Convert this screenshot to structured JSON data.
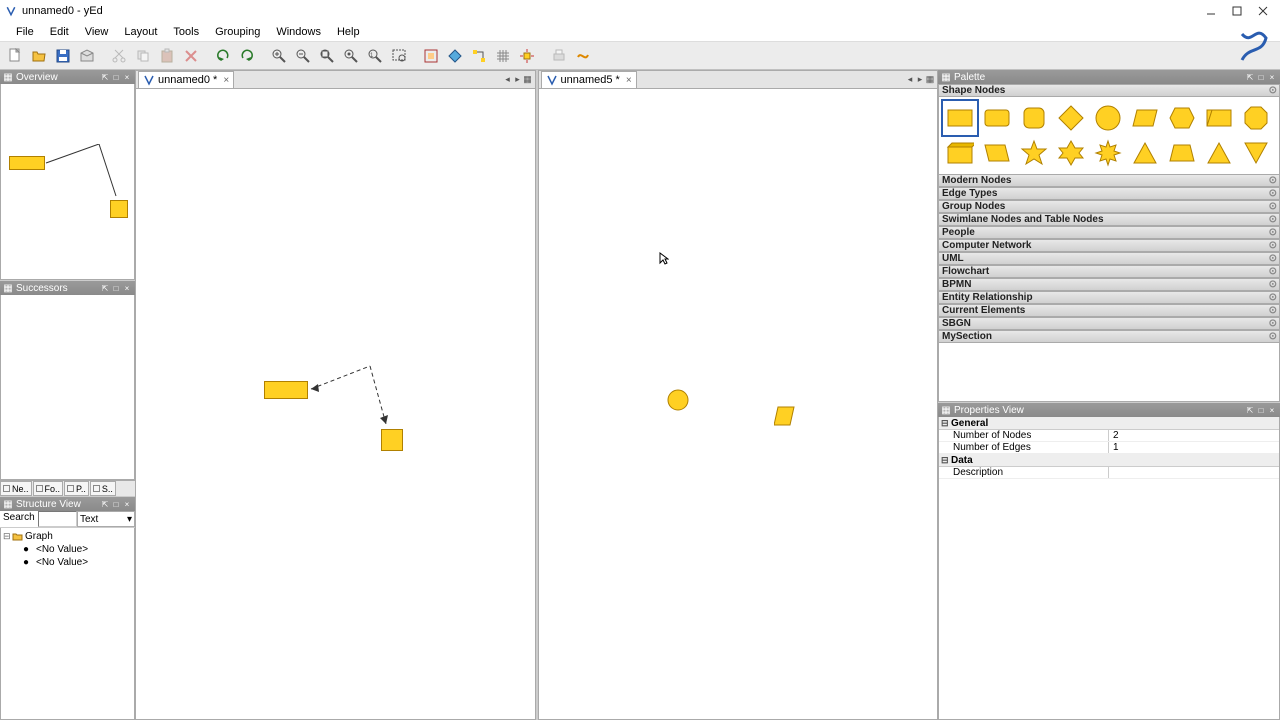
{
  "window": {
    "title": "unnamed0 - yEd"
  },
  "menu": [
    "File",
    "Edit",
    "View",
    "Layout",
    "Tools",
    "Grouping",
    "Windows",
    "Help"
  ],
  "tabs": [
    {
      "label": "unnamed0 *",
      "close": "×"
    },
    {
      "label": "unnamed5 *",
      "close": "×"
    }
  ],
  "left": {
    "overview": "Overview",
    "successors": "Successors",
    "neighborhood": "Neighborhood",
    "structure": "Structure View",
    "nb_tabs": [
      "Ne..",
      "Fo..",
      "P..",
      "S.."
    ],
    "search_label": "Search",
    "search_mode": "Text",
    "tree": {
      "root": "Graph",
      "child1": "<No Value>",
      "child2": "<No Value>"
    }
  },
  "palette": {
    "title": "Palette",
    "section_shapes": "Shape Nodes",
    "sections": [
      "Modern Nodes",
      "Edge Types",
      "Group Nodes",
      "Swimlane Nodes and Table Nodes",
      "People",
      "Computer Network",
      "UML",
      "Flowchart",
      "BPMN",
      "Entity Relationship",
      "Current Elements",
      "SBGN",
      "MySection"
    ]
  },
  "props": {
    "title": "Properties View",
    "group_general": "General",
    "row_nodes_k": "Number of Nodes",
    "row_nodes_v": "2",
    "row_edges_k": "Number of Edges",
    "row_edges_v": "1",
    "group_data": "Data",
    "row_desc_k": "Description",
    "row_desc_v": ""
  }
}
